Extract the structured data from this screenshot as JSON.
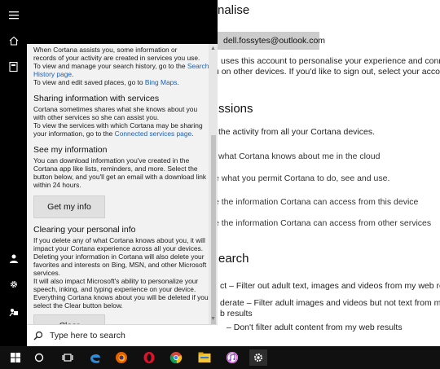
{
  "settings_bg": {
    "heading_personalise": "nalise",
    "email": "dell.fossytes@outlook.com",
    "account_line1": "uses this account to personalise your experience and connect",
    "account_line2": "u on other devices. If you'd like to sign out, select your account.",
    "heading_permissions": "ssions",
    "activity_line": "the activity from all your Cortana devices.",
    "link_cloud": "what Cortana knows about me in the cloud",
    "link_permit": "e what you permit Cortana to do, see and use.",
    "link_device": "e the information Cortana can access from this device",
    "link_services": "e the information Cortana can access from other services",
    "heading_search": "earch",
    "search_strict": "ct – Filter out adult text, images and videos from my web results",
    "search_moderate_1": "derate – Filter adult images and videos but not text from my",
    "search_moderate_2": "b results",
    "search_off": "– Don't filter adult content from my web results"
  },
  "panel": {
    "intro_1": "When Cortana assists you, some information or",
    "intro_2": "records of your activity are created in services you use.",
    "intro_3": "To view and manage your search history, go to the",
    "intro_link_search": "Search History page",
    "intro_4": "To view and edit saved places, go to",
    "intro_link_maps": "Bing Maps",
    "sharing_title": "Sharing information with services",
    "sharing_1": "Cortana sometimes shares what she knows about you with other services so she can assist you.",
    "sharing_2": "To view the services with which Cortana may be sharing your information, go to the",
    "sharing_link": "Connected services page",
    "see_title": "See my information",
    "see_body": "You can download information you've created in the Cortana app like lists, reminders, and more. Select the button below, and you'll get an email with a download link within 24 hours.",
    "get_info_button": "Get my info",
    "clear_title": "Clearing your personal info",
    "clear_body_1": "If you delete any of what Cortana knows about you, it will impact your Cortana experience across all your devices. Deleting your information in Cortana will also delete your favorites and interests on Bing, MSN, and other Microsoft services.",
    "clear_body_2": "It will also impact Microsoft's ability to personalize your speech, inking, and typing experience on your device. Everything Cortana knows about you will be deleted if you select the Clear button below.",
    "clear_button": "Clear"
  },
  "search_box": {
    "placeholder": "Type here to search"
  },
  "colors": {
    "rail": "#000000",
    "panel": "#f2f2f2",
    "taskbar": "#101010",
    "link": "#1a5fb4"
  },
  "taskbar_icons": [
    "windows-start-icon",
    "cortana-circle-icon",
    "task-view-icon",
    "edge-icon",
    "firefox-icon",
    "opera-icon",
    "chrome-icon",
    "file-explorer-icon",
    "itunes-icon",
    "settings-gear-icon"
  ]
}
